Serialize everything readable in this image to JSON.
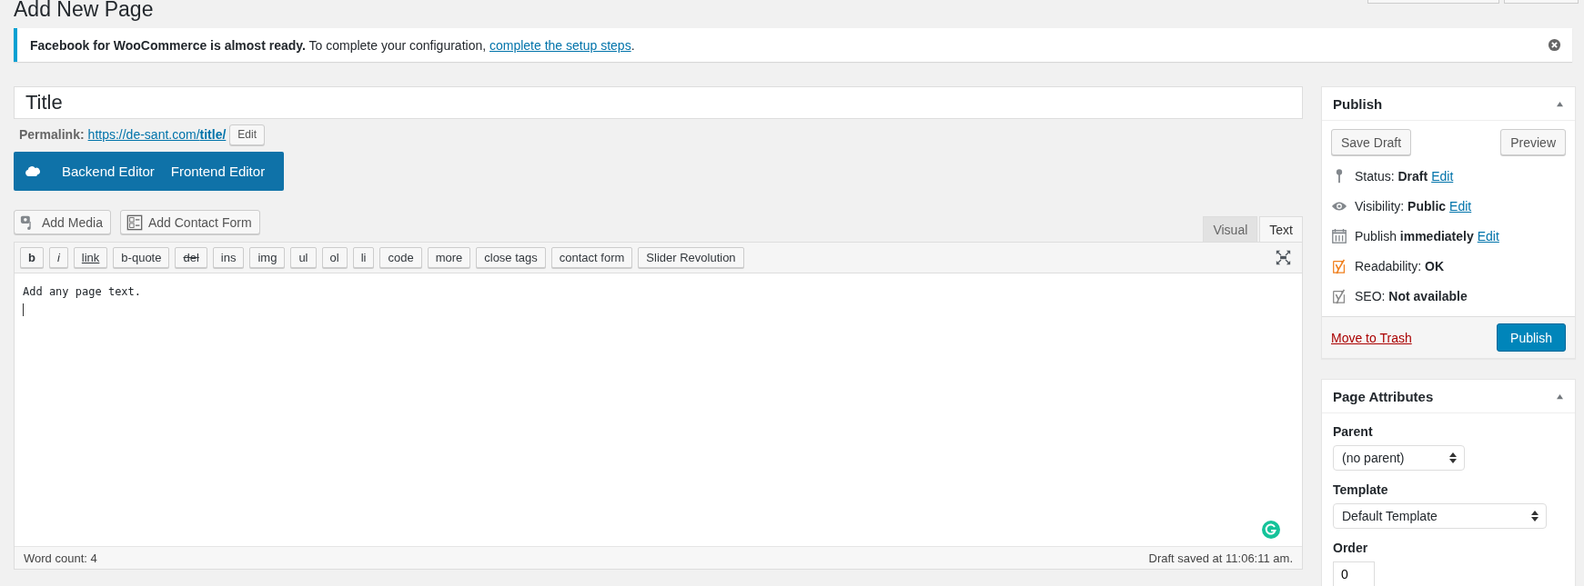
{
  "page_title": "Add New Page",
  "notice": {
    "text": "**Facebook for WooCommerce is almost ready.** To complete your configuration, ",
    "link": "complete the setup steps",
    "after": "."
  },
  "title_field": {
    "value": "Title"
  },
  "permalink": {
    "label": "Permalink:",
    "url": "https://de-sant.com/**title/**",
    "edit_button": "Edit"
  },
  "builder_buttons": [
    "Backend Editor",
    "Frontend Editor"
  ],
  "media_buttons": [
    {
      "label": "Add Media",
      "kind": "media"
    },
    {
      "label": "Add Contact Form",
      "kind": "form"
    }
  ],
  "editor_tabs": [
    {
      "label": "Visual",
      "selected": false
    },
    {
      "label": "Text",
      "selected": true
    }
  ],
  "quicktags": [
    {
      "label": "b",
      "kind": "bold"
    },
    {
      "label": "i",
      "kind": "italic"
    },
    {
      "label": "link",
      "kind": "underline"
    },
    {
      "label": "b-quote",
      "kind": "plain"
    },
    {
      "label": "del",
      "kind": "strike"
    },
    {
      "label": "ins",
      "kind": "plain"
    },
    {
      "label": "img",
      "kind": "plain"
    },
    {
      "label": "ul",
      "kind": "plain"
    },
    {
      "label": "ol",
      "kind": "plain"
    },
    {
      "label": "li",
      "kind": "plain"
    },
    {
      "label": "code",
      "kind": "plain"
    },
    {
      "label": "more",
      "kind": "plain"
    },
    {
      "label": "close tags",
      "kind": "plain"
    },
    {
      "label": "contact form",
      "kind": "plain"
    },
    {
      "label": "Slider Revolution",
      "kind": "plain"
    }
  ],
  "editor": {
    "content": "Add any page text."
  },
  "status_bar": {
    "word_count": "Word count: 4",
    "saved": "Draft saved at 11:06:11 am."
  },
  "publish_box": {
    "title": "Publish",
    "save_draft": "Save Draft",
    "preview": "Preview",
    "rows": [
      {
        "kind": "pin",
        "text": "Status: **Draft**",
        "link": "Edit"
      },
      {
        "kind": "eye",
        "text": "Visibility: **Public**",
        "link": "Edit"
      },
      {
        "kind": "calendar",
        "text": "Publish **immediately**",
        "link": "Edit"
      },
      {
        "kind": "yoast",
        "color": "#f0801f",
        "text": "Readability: **OK**"
      },
      {
        "kind": "yoast",
        "color": "#888888",
        "text": "SEO: **Not available**"
      }
    ],
    "trash": "Move to Trash",
    "publish": "Publish"
  },
  "page_attributes": {
    "title": "Page Attributes",
    "parent_label": "Parent",
    "parent_value": "(no parent)",
    "template_label": "Template",
    "template_value": "Default Template",
    "order_label": "Order",
    "order_value": "0"
  }
}
